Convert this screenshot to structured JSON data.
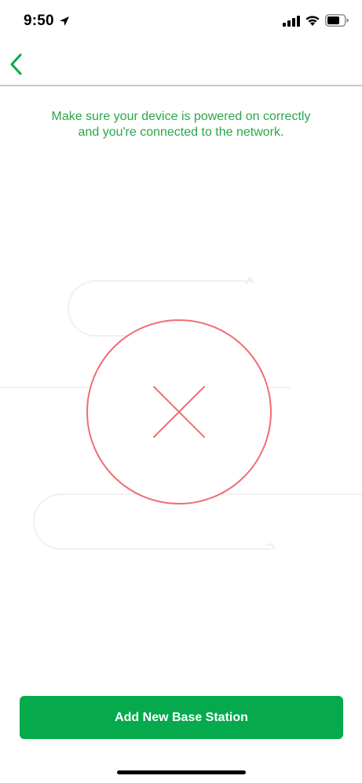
{
  "status_bar": {
    "time": "9:50",
    "icons": [
      "location-arrow-icon",
      "cellular-signal-icon",
      "wifi-icon",
      "battery-icon"
    ]
  },
  "nav": {
    "back_icon": "chevron-left-icon"
  },
  "message": "Make sure your device is powered on correctly and you're connected to the network.",
  "illustration": {
    "status_icon": "error-x-icon"
  },
  "actions": {
    "add_base_station_label": "Add New Base Station"
  },
  "colors": {
    "accent_green": "#06aa4d",
    "message_green": "#2aa64a",
    "error_red": "#ee6e73",
    "divider": "#c8c8c8"
  }
}
